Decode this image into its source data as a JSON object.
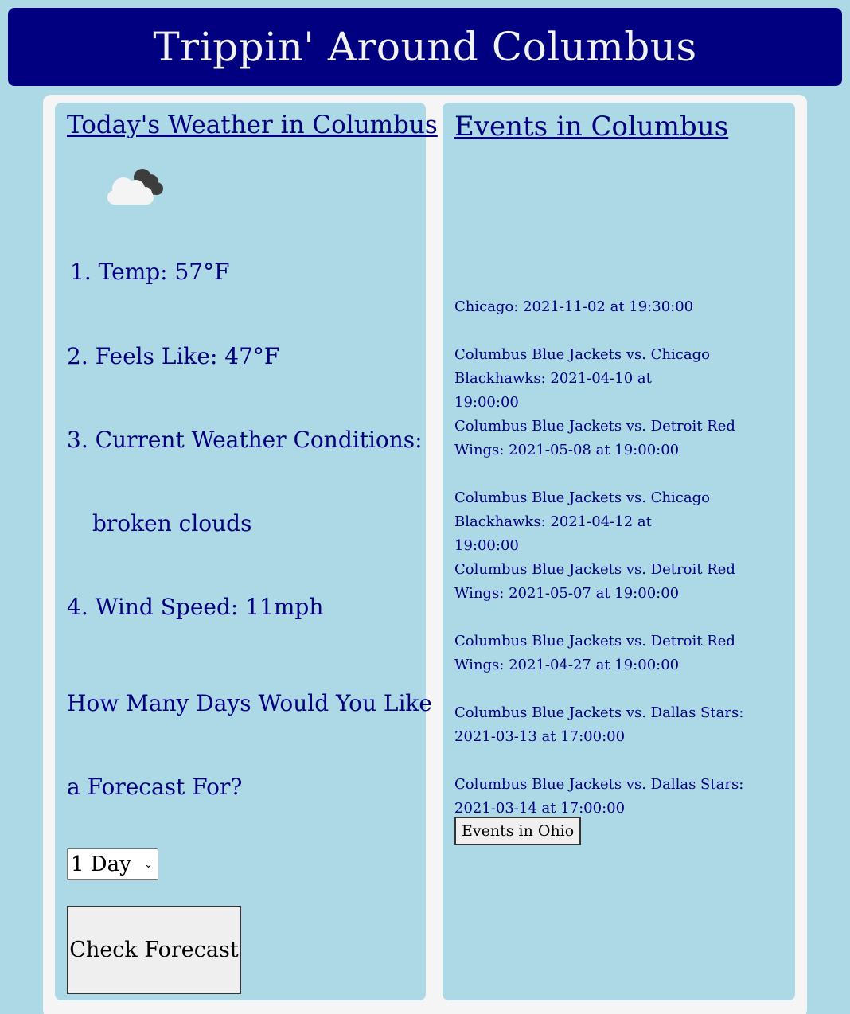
{
  "header": {
    "title": "Trippin' Around Columbus"
  },
  "weather": {
    "title": "Today's Weather in Columbus",
    "icon": "broken-clouds-icon",
    "items": [
      "1. Temp: 57°F",
      "2. Feels Like: 47°F",
      "3. Current Weather Conditions:",
      "broken clouds",
      "4. Wind Speed: 11mph"
    ],
    "question_line1": "How Many Days Would You Like",
    "question_line2": "a Forecast For?",
    "select_value": "1 Day",
    "check_button": "Check Forecast"
  },
  "events": {
    "title": "Events in Columbus",
    "items": [
      "Chicago: 2021-11-02 at 19:30:00",
      "Columbus Blue Jackets vs. Chicago Blackhawks: 2021-04-10 at 19:00:00",
      "Columbus Blue Jackets vs. Detroit Red Wings: 2021-05-08 at 19:00:00",
      "Columbus Blue Jackets vs. Chicago Blackhawks: 2021-04-12 at 19:00:00",
      "Columbus Blue Jackets vs. Detroit Red Wings: 2021-05-07 at 19:00:00",
      "Columbus Blue Jackets vs. Detroit Red Wings: 2021-04-27 at 19:00:00",
      "Columbus Blue Jackets vs. Dallas Stars: 2021-03-13 at 17:00:00",
      "Columbus Blue Jackets vs. Dallas Stars: 2021-03-14 at 17:00:00"
    ],
    "ohio_button": "Events in Ohio"
  }
}
